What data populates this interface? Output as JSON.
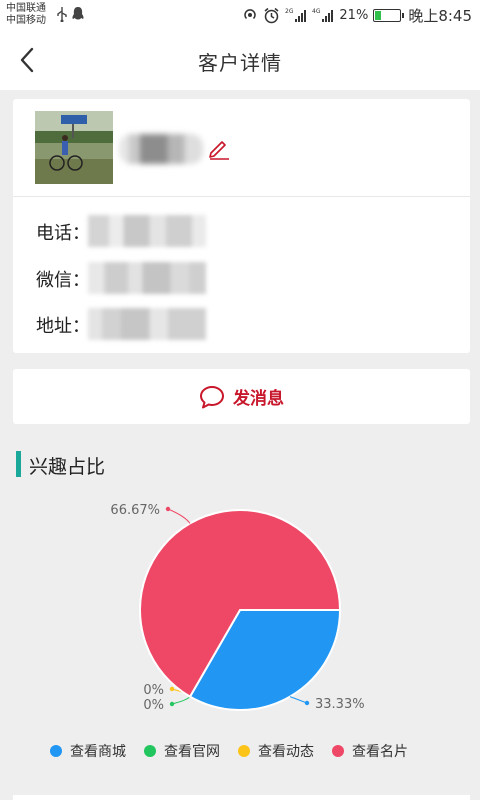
{
  "status_bar": {
    "carrier1": "中国联通",
    "carrier2": "中国移动",
    "battery": "21%",
    "battery_level": 0.21,
    "time": "晚上8:45"
  },
  "nav": {
    "title": "客户详情"
  },
  "profile": {
    "phone_label": "电话：",
    "wechat_label": "微信：",
    "address_label": "地址："
  },
  "actions": {
    "send_message": "发消息"
  },
  "section": {
    "interest_title": "兴趣占比"
  },
  "colors": {
    "accent_red": "#c8162b",
    "section_bar": "#1aa89a"
  },
  "chart_data": {
    "type": "pie",
    "slices": [
      {
        "name": "查看商城",
        "value": 33.33,
        "label": "33.33%",
        "color": "#2196f3"
      },
      {
        "name": "查看官网",
        "value": 0,
        "label": "0%",
        "color": "#22c55e"
      },
      {
        "name": "查看动态",
        "value": 0,
        "label": "0%",
        "color": "#fcc419"
      },
      {
        "name": "查看名片",
        "value": 66.67,
        "label": "66.67%",
        "color": "#ef4866"
      }
    ],
    "legend_position": "bottom"
  }
}
